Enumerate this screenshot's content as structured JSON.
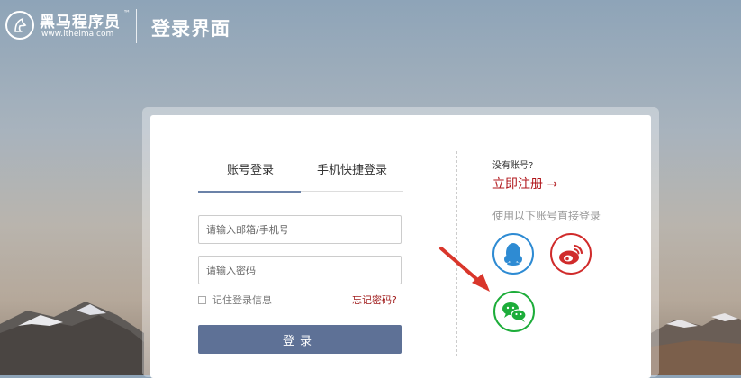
{
  "header": {
    "brand_name": "黑马程序员",
    "brand_tm": "™",
    "brand_url": "www.itheima.com",
    "page_title": "登录界面"
  },
  "login": {
    "tabs": [
      {
        "label": "账号登录",
        "active": true
      },
      {
        "label": "手机快捷登录",
        "active": false
      }
    ],
    "username_placeholder": "请输入邮箱/手机号",
    "password_placeholder": "请输入密码",
    "remember_label": "记住登录信息",
    "forgot_label": "忘记密码?",
    "submit_label": "登录"
  },
  "side": {
    "no_account": "没有账号?",
    "register_label": "立即注册 →",
    "use_below": "使用以下账号直接登录",
    "providers": [
      {
        "name": "qq",
        "icon": "qq-penguin-icon",
        "color": "#2e8bd3"
      },
      {
        "name": "weibo",
        "icon": "weibo-icon",
        "color": "#d02b2b"
      },
      {
        "name": "wechat",
        "icon": "wechat-icon",
        "color": "#1dad3a"
      }
    ]
  },
  "annotation": {
    "icon": "red-arrow-pointer",
    "color": "#d9362b"
  },
  "colors": {
    "accent": "#5e7196",
    "link_red": "#b0161b"
  }
}
